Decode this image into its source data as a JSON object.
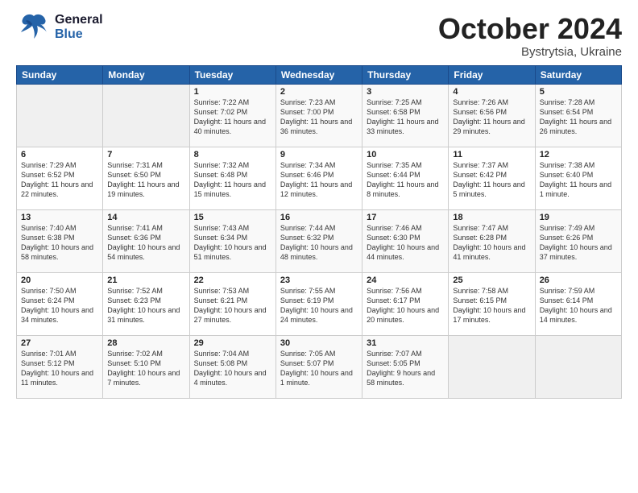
{
  "header": {
    "logo": {
      "general": "General",
      "blue": "Blue"
    },
    "title": "October 2024",
    "location": "Bystrytsia, Ukraine"
  },
  "calendar": {
    "days": [
      "Sunday",
      "Monday",
      "Tuesday",
      "Wednesday",
      "Thursday",
      "Friday",
      "Saturday"
    ],
    "weeks": [
      [
        {
          "num": "",
          "sunrise": "",
          "sunset": "",
          "daylight": ""
        },
        {
          "num": "",
          "sunrise": "",
          "sunset": "",
          "daylight": ""
        },
        {
          "num": "1",
          "sunrise": "Sunrise: 7:22 AM",
          "sunset": "Sunset: 7:02 PM",
          "daylight": "Daylight: 11 hours and 40 minutes."
        },
        {
          "num": "2",
          "sunrise": "Sunrise: 7:23 AM",
          "sunset": "Sunset: 7:00 PM",
          "daylight": "Daylight: 11 hours and 36 minutes."
        },
        {
          "num": "3",
          "sunrise": "Sunrise: 7:25 AM",
          "sunset": "Sunset: 6:58 PM",
          "daylight": "Daylight: 11 hours and 33 minutes."
        },
        {
          "num": "4",
          "sunrise": "Sunrise: 7:26 AM",
          "sunset": "Sunset: 6:56 PM",
          "daylight": "Daylight: 11 hours and 29 minutes."
        },
        {
          "num": "5",
          "sunrise": "Sunrise: 7:28 AM",
          "sunset": "Sunset: 6:54 PM",
          "daylight": "Daylight: 11 hours and 26 minutes."
        }
      ],
      [
        {
          "num": "6",
          "sunrise": "Sunrise: 7:29 AM",
          "sunset": "Sunset: 6:52 PM",
          "daylight": "Daylight: 11 hours and 22 minutes."
        },
        {
          "num": "7",
          "sunrise": "Sunrise: 7:31 AM",
          "sunset": "Sunset: 6:50 PM",
          "daylight": "Daylight: 11 hours and 19 minutes."
        },
        {
          "num": "8",
          "sunrise": "Sunrise: 7:32 AM",
          "sunset": "Sunset: 6:48 PM",
          "daylight": "Daylight: 11 hours and 15 minutes."
        },
        {
          "num": "9",
          "sunrise": "Sunrise: 7:34 AM",
          "sunset": "Sunset: 6:46 PM",
          "daylight": "Daylight: 11 hours and 12 minutes."
        },
        {
          "num": "10",
          "sunrise": "Sunrise: 7:35 AM",
          "sunset": "Sunset: 6:44 PM",
          "daylight": "Daylight: 11 hours and 8 minutes."
        },
        {
          "num": "11",
          "sunrise": "Sunrise: 7:37 AM",
          "sunset": "Sunset: 6:42 PM",
          "daylight": "Daylight: 11 hours and 5 minutes."
        },
        {
          "num": "12",
          "sunrise": "Sunrise: 7:38 AM",
          "sunset": "Sunset: 6:40 PM",
          "daylight": "Daylight: 11 hours and 1 minute."
        }
      ],
      [
        {
          "num": "13",
          "sunrise": "Sunrise: 7:40 AM",
          "sunset": "Sunset: 6:38 PM",
          "daylight": "Daylight: 10 hours and 58 minutes."
        },
        {
          "num": "14",
          "sunrise": "Sunrise: 7:41 AM",
          "sunset": "Sunset: 6:36 PM",
          "daylight": "Daylight: 10 hours and 54 minutes."
        },
        {
          "num": "15",
          "sunrise": "Sunrise: 7:43 AM",
          "sunset": "Sunset: 6:34 PM",
          "daylight": "Daylight: 10 hours and 51 minutes."
        },
        {
          "num": "16",
          "sunrise": "Sunrise: 7:44 AM",
          "sunset": "Sunset: 6:32 PM",
          "daylight": "Daylight: 10 hours and 48 minutes."
        },
        {
          "num": "17",
          "sunrise": "Sunrise: 7:46 AM",
          "sunset": "Sunset: 6:30 PM",
          "daylight": "Daylight: 10 hours and 44 minutes."
        },
        {
          "num": "18",
          "sunrise": "Sunrise: 7:47 AM",
          "sunset": "Sunset: 6:28 PM",
          "daylight": "Daylight: 10 hours and 41 minutes."
        },
        {
          "num": "19",
          "sunrise": "Sunrise: 7:49 AM",
          "sunset": "Sunset: 6:26 PM",
          "daylight": "Daylight: 10 hours and 37 minutes."
        }
      ],
      [
        {
          "num": "20",
          "sunrise": "Sunrise: 7:50 AM",
          "sunset": "Sunset: 6:24 PM",
          "daylight": "Daylight: 10 hours and 34 minutes."
        },
        {
          "num": "21",
          "sunrise": "Sunrise: 7:52 AM",
          "sunset": "Sunset: 6:23 PM",
          "daylight": "Daylight: 10 hours and 31 minutes."
        },
        {
          "num": "22",
          "sunrise": "Sunrise: 7:53 AM",
          "sunset": "Sunset: 6:21 PM",
          "daylight": "Daylight: 10 hours and 27 minutes."
        },
        {
          "num": "23",
          "sunrise": "Sunrise: 7:55 AM",
          "sunset": "Sunset: 6:19 PM",
          "daylight": "Daylight: 10 hours and 24 minutes."
        },
        {
          "num": "24",
          "sunrise": "Sunrise: 7:56 AM",
          "sunset": "Sunset: 6:17 PM",
          "daylight": "Daylight: 10 hours and 20 minutes."
        },
        {
          "num": "25",
          "sunrise": "Sunrise: 7:58 AM",
          "sunset": "Sunset: 6:15 PM",
          "daylight": "Daylight: 10 hours and 17 minutes."
        },
        {
          "num": "26",
          "sunrise": "Sunrise: 7:59 AM",
          "sunset": "Sunset: 6:14 PM",
          "daylight": "Daylight: 10 hours and 14 minutes."
        }
      ],
      [
        {
          "num": "27",
          "sunrise": "Sunrise: 7:01 AM",
          "sunset": "Sunset: 5:12 PM",
          "daylight": "Daylight: 10 hours and 11 minutes."
        },
        {
          "num": "28",
          "sunrise": "Sunrise: 7:02 AM",
          "sunset": "Sunset: 5:10 PM",
          "daylight": "Daylight: 10 hours and 7 minutes."
        },
        {
          "num": "29",
          "sunrise": "Sunrise: 7:04 AM",
          "sunset": "Sunset: 5:08 PM",
          "daylight": "Daylight: 10 hours and 4 minutes."
        },
        {
          "num": "30",
          "sunrise": "Sunrise: 7:05 AM",
          "sunset": "Sunset: 5:07 PM",
          "daylight": "Daylight: 10 hours and 1 minute."
        },
        {
          "num": "31",
          "sunrise": "Sunrise: 7:07 AM",
          "sunset": "Sunset: 5:05 PM",
          "daylight": "Daylight: 9 hours and 58 minutes."
        },
        {
          "num": "",
          "sunrise": "",
          "sunset": "",
          "daylight": ""
        },
        {
          "num": "",
          "sunrise": "",
          "sunset": "",
          "daylight": ""
        }
      ]
    ]
  }
}
